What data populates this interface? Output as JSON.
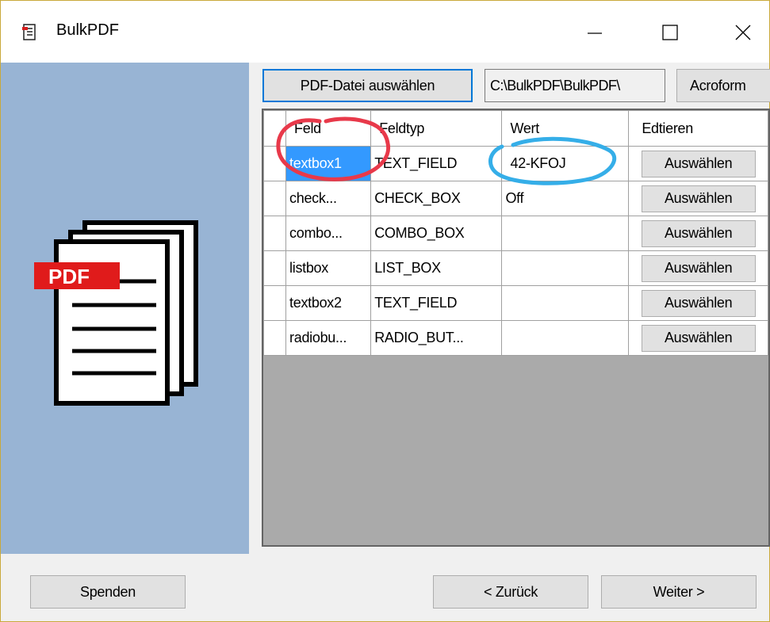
{
  "window": {
    "title": "BulkPDF",
    "controls": {
      "minimize": "—",
      "maximize": "☐",
      "close": "✕"
    }
  },
  "toolbar": {
    "select_pdf_label": "PDF-Datei auswählen",
    "path_value": "C:\\BulkPDF\\BulkPDF\\",
    "acroform_label": "Acroform"
  },
  "logo": {
    "text": "PDF"
  },
  "grid": {
    "columns": [
      "Feld",
      "Feldtyp",
      "Wert",
      "Edtieren"
    ],
    "rows": [
      {
        "feld": "textbox1",
        "typ": "TEXT_FIELD",
        "wert": "42-KFOJ",
        "edit": "Auswählen"
      },
      {
        "feld": "check...",
        "typ": "CHECK_BOX",
        "wert": "Off",
        "edit": "Auswählen"
      },
      {
        "feld": "combo...",
        "typ": "COMBO_BOX",
        "wert": "",
        "edit": "Auswählen"
      },
      {
        "feld": "listbox",
        "typ": "LIST_BOX",
        "wert": "",
        "edit": "Auswählen"
      },
      {
        "feld": "textbox2",
        "typ": "TEXT_FIELD",
        "wert": "",
        "edit": "Auswählen"
      },
      {
        "feld": "radiobu...",
        "typ": "RADIO_BUT...",
        "wert": "",
        "edit": "Auswählen"
      }
    ]
  },
  "footer": {
    "donate_label": "Spenden",
    "back_label": "< Zurück",
    "next_label": "Weiter >"
  },
  "colors": {
    "left_panel": "#98b4d4",
    "selection": "#3399ff",
    "annotation_red": "#e8394a",
    "annotation_blue": "#35aee8"
  }
}
